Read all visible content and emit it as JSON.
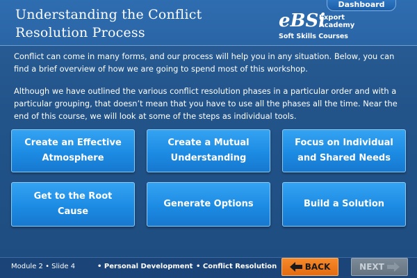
{
  "header": {
    "title": "Understanding the Conflict Resolution Process",
    "dashboard_label": "Dashboard",
    "logo": {
      "mark": "eBSi",
      "line1": "Export",
      "line2": "Academy",
      "subtitle": "Soft Skills Courses"
    }
  },
  "content": {
    "paragraph1": "Conflict can come in many forms, and our process will help you in any situation. Below, you can find a brief overview of how we are going to spend most of this workshop.",
    "paragraph2": "Although we have outlined the various conflict resolution phases in a particular order and with a particular grouping, that doesn’t mean that you have to use all the phases all the time. Near the end of this course, we will look at some of the steps as individual tools."
  },
  "phases": [
    {
      "label": "Create an Effective Atmosphere"
    },
    {
      "label": "Create a Mutual Understanding"
    },
    {
      "label": "Focus on Individual and Shared Needs"
    },
    {
      "label": "Get to the Root Cause"
    },
    {
      "label": "Generate Options"
    },
    {
      "label": "Build a Solution"
    }
  ],
  "footer": {
    "module_slide": "Module 2 • Slide 4",
    "category1": "• Personal Development",
    "category2": "• Conflict Resolution",
    "back_label": "BACK",
    "next_label": "NEXT"
  },
  "colors": {
    "background": "#22548a",
    "phase_button": "#1c8be3",
    "back_button": "#e46b10",
    "next_button_disabled": "#66737f"
  }
}
